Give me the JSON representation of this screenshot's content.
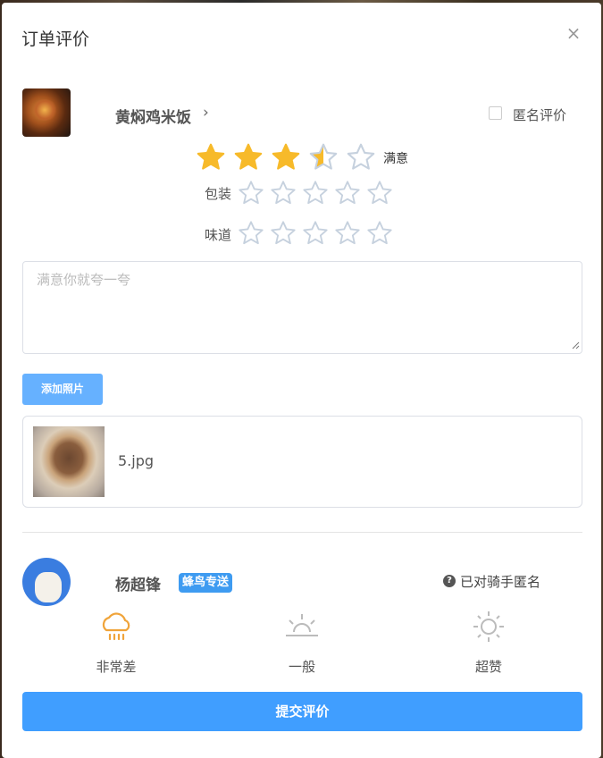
{
  "dialog": {
    "title": "订单评价",
    "close_label": "×"
  },
  "product": {
    "name": "黄焖鸡米饭",
    "arrow": "›",
    "anonymous_label": "匿名评价",
    "anonymous_checked": false
  },
  "ratings": {
    "overall": {
      "value": 3.5,
      "max": 5,
      "text": "满意"
    },
    "packaging": {
      "label": "包装",
      "value": 0,
      "max": 5
    },
    "taste": {
      "label": "味道",
      "value": 0,
      "max": 5
    }
  },
  "comment": {
    "placeholder": "满意你就夸一夸",
    "value": ""
  },
  "photos": {
    "add_label": "添加照片",
    "files": [
      {
        "name": "5.jpg"
      }
    ]
  },
  "rider": {
    "name": "杨超锋",
    "tag": "蜂鸟专送",
    "anonymous_text": "已对骑手匿名",
    "moods": [
      {
        "label": "非常差",
        "icon": "rain-cloud-icon",
        "color": "#f0a43a"
      },
      {
        "label": "一般",
        "icon": "sunset-icon",
        "color": "#bbbbbb"
      },
      {
        "label": "超赞",
        "icon": "sun-icon",
        "color": "#bbbbbb"
      }
    ]
  },
  "submit_label": "提交评价",
  "colors": {
    "star_filled": "#f7ba2a",
    "star_empty": "#c6d1de",
    "primary": "#409eff",
    "add_photo": "#66b1ff"
  }
}
